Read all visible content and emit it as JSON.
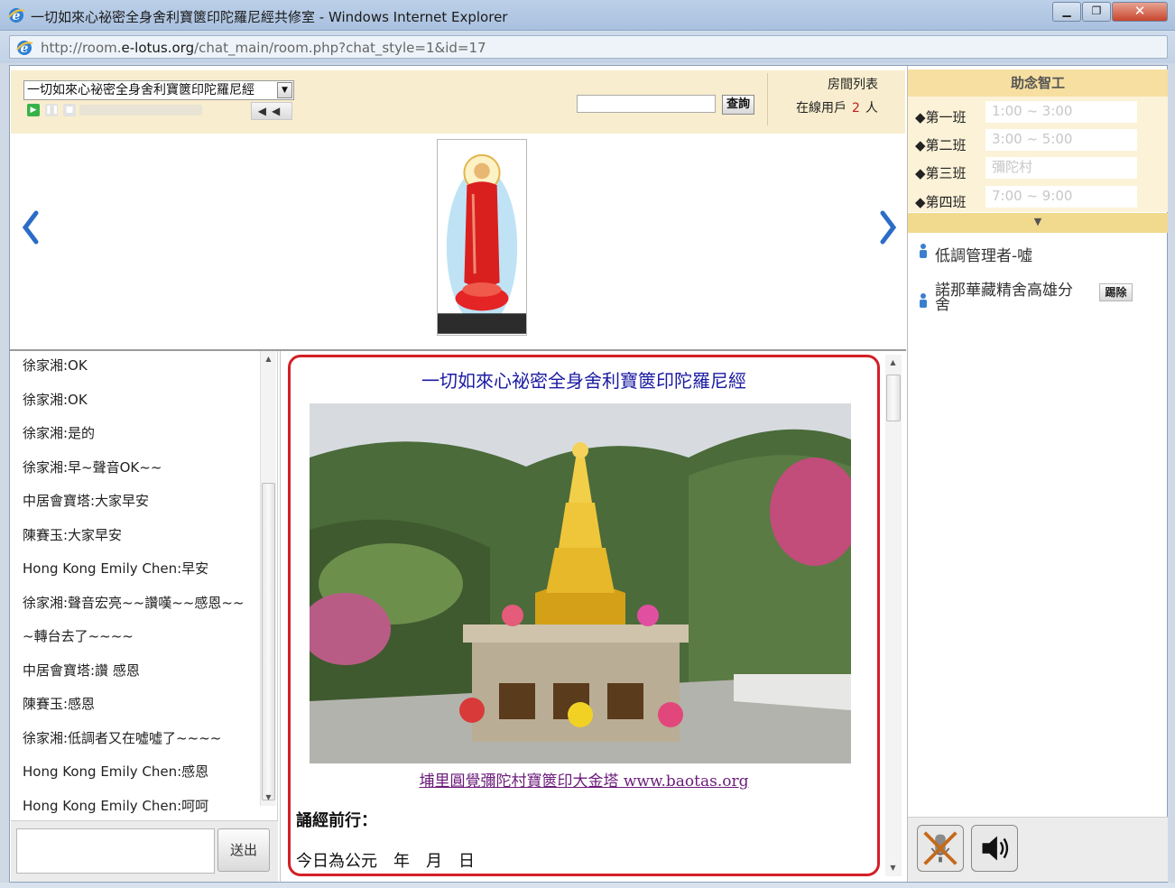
{
  "window": {
    "title": "一切如來心祕密全身舍利寶篋印陀羅尼經共修室 - Windows Internet Explorer",
    "url_prefix": "http://room.",
    "url_domain": "e-lotus.org",
    "url_path": "/chat_main/room.php?chat_style=1&id=17"
  },
  "toolbar": {
    "selected_sutra": "一切如來心祕密全身舍利寶篋印陀羅尼經",
    "search_button": "查詢",
    "room_list": "房間列表",
    "online_label": "在線用戶",
    "online_count": "2",
    "online_unit": "人"
  },
  "chat": {
    "messages": [
      "徐家湘:OK",
      "徐家湘:OK",
      "徐家湘:是的",
      "徐家湘:早~聲音OK~~",
      "中居會寶塔:大家早安",
      "陳賽玉:大家早安",
      "Hong Kong Emily Chen:早安",
      "徐家湘:聲音宏亮~~讚嘆~~感恩~~",
      "~轉台去了~~~~",
      "中居會寶塔:讚 感恩",
      "陳賽玉:感恩",
      "徐家湘:低調者又在噓噓了~~~~",
      "Hong Kong Emily Chen:感恩",
      "Hong Kong Emily Chen:呵呵"
    ],
    "send_button": "送出"
  },
  "scripture": {
    "title": "一切如來心祕密全身舍利寶篋印陀羅尼經",
    "caption": "埔里圓覺彌陀村寶篋印大金塔 www.baotas.org",
    "heading": "誦經前行：",
    "date_line": "今日為公元　年　月　日"
  },
  "helpers": {
    "title": "助念智工",
    "shifts": [
      {
        "label": "◆第一班",
        "value": "1:00 ~ 3:00"
      },
      {
        "label": "◆第二班",
        "value": "3:00 ~ 5:00"
      },
      {
        "label": "◆第三班",
        "value": "彌陀村"
      },
      {
        "label": "◆第四班",
        "value": "7:00 ~ 9:00"
      }
    ]
  },
  "users": [
    {
      "name": "低調管理者-噓"
    },
    {
      "name_line1": "諾那華藏精舍高雄分",
      "name_line2": "舍",
      "kick": "踢除"
    }
  ],
  "colors": {
    "accent_red": "#d41f26",
    "toolbar_bg": "#f8edce",
    "helper_header": "#f6dfa0",
    "title_blue": "#1a1aa2"
  }
}
